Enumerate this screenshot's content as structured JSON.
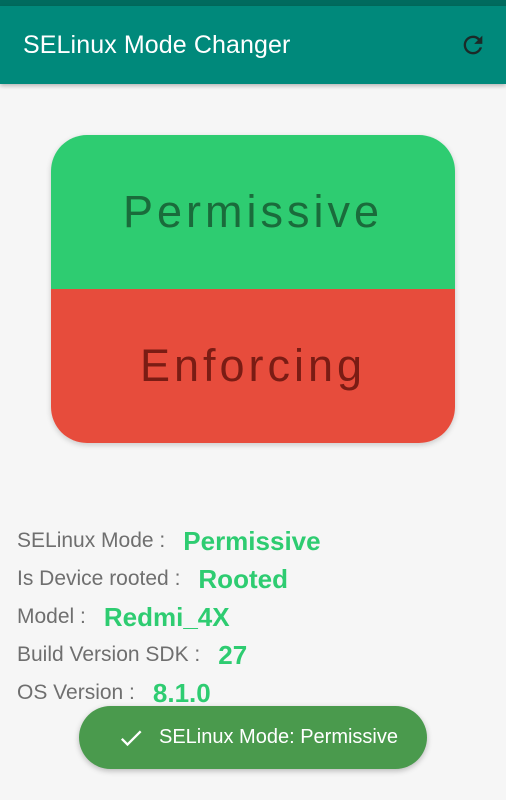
{
  "app_bar": {
    "title": "SELinux Mode Changer",
    "refresh_icon": "refresh-icon",
    "color": "#00897b"
  },
  "mode_toggle": {
    "permissive_label": "Permissive",
    "enforcing_label": "Enforcing",
    "permissive_color": "#2ecc71",
    "enforcing_color": "#e74c3c"
  },
  "info": {
    "rows": [
      {
        "label": "SELinux Mode :",
        "value": "Permissive"
      },
      {
        "label": "Is Device rooted :",
        "value": "Rooted"
      },
      {
        "label": "Model :",
        "value": "Redmi_4X"
      },
      {
        "label": "Build Version SDK :",
        "value": "27"
      },
      {
        "label": "OS Version :",
        "value": "8.1.0"
      }
    ],
    "value_color": "#2ecc71"
  },
  "toast": {
    "icon": "check-icon",
    "message": "SELinux Mode: Permissive",
    "color": "#4a9a4d"
  }
}
